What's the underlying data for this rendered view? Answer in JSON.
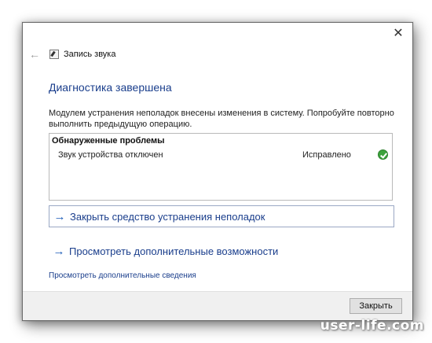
{
  "window": {
    "title": "Запись звука",
    "close_glyph": "✕",
    "back_glyph": "←"
  },
  "heading": "Диагностика завершена",
  "message": "Модулем устранения неполадок внесены изменения в систему. Попробуйте повторно выполнить предыдущую операцию.",
  "problems": {
    "header": "Обнаруженные проблемы",
    "rows": [
      {
        "name": "Звук устройства отключен",
        "status": "Исправлено",
        "status_icon": "check-icon"
      }
    ]
  },
  "options": [
    {
      "label": "Закрыть средство устранения неполадок",
      "arrow": "→"
    },
    {
      "label": "Просмотреть дополнительные возможности",
      "arrow": "→"
    }
  ],
  "details_link": "Просмотреть дополнительные сведения",
  "footer": {
    "close_label": "Закрыть"
  },
  "watermark": "user-life.com",
  "colors": {
    "accent": "#1a3e8c",
    "success": "#3da33d"
  }
}
